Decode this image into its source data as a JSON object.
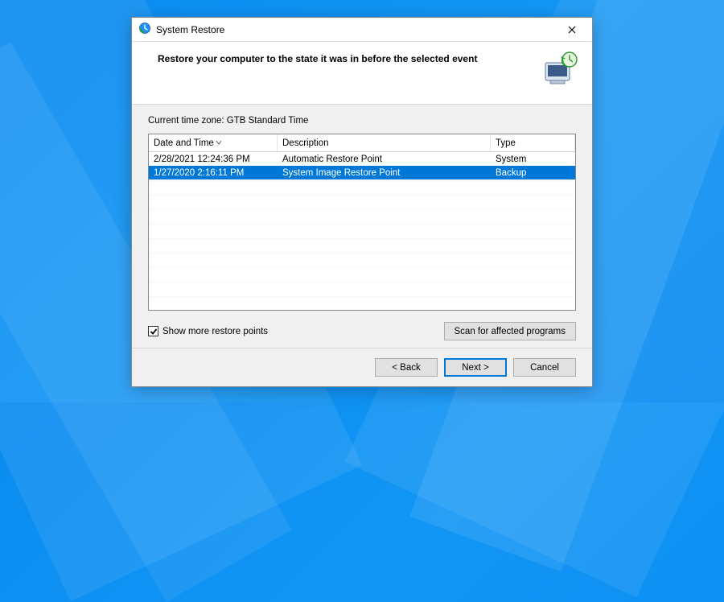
{
  "window": {
    "title": "System Restore",
    "heading": "Restore your computer to the state it was in before the selected event"
  },
  "timezone_label": "Current time zone: GTB Standard Time",
  "columns": {
    "datetime": "Date and Time",
    "description": "Description",
    "type": "Type"
  },
  "restore_points": [
    {
      "datetime": "2/28/2021 12:24:36 PM",
      "description": "Automatic Restore Point",
      "type": "System",
      "selected": false
    },
    {
      "datetime": "1/27/2020 2:16:11 PM",
      "description": "System Image Restore Point",
      "type": "Backup",
      "selected": true
    }
  ],
  "checkbox": {
    "label": "Show more restore points",
    "checked": true
  },
  "buttons": {
    "scan": "Scan for affected programs",
    "back": "< Back",
    "next": "Next >",
    "cancel": "Cancel"
  },
  "colors": {
    "selection": "#0078d7",
    "dialog_bg": "#f0f0f0"
  }
}
